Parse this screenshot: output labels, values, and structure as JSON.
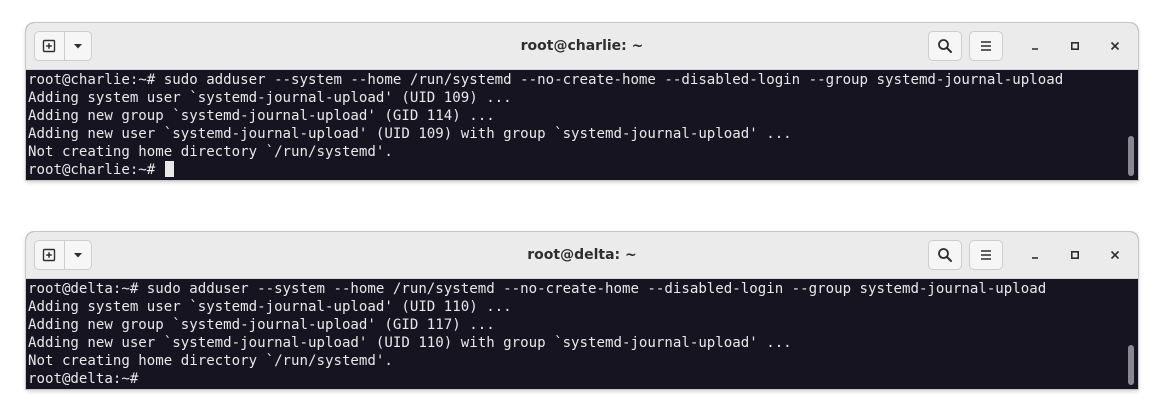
{
  "windows": [
    {
      "title": "root@charlie: ~",
      "lines": [
        "root@charlie:~# sudo adduser --system --home /run/systemd --no-create-home --disabled-login --group systemd-journal-upload",
        "Adding system user `systemd-journal-upload' (UID 109) ...",
        "Adding new group `systemd-journal-upload' (GID 114) ...",
        "Adding new user `systemd-journal-upload' (UID 109) with group `systemd-journal-upload' ...",
        "Not creating home directory `/run/systemd'.",
        "root@charlie:~# "
      ],
      "cursor_visible": true
    },
    {
      "title": "root@delta: ~",
      "lines": [
        "root@delta:~# sudo adduser --system --home /run/systemd --no-create-home --disabled-login --group systemd-journal-upload",
        "Adding system user `systemd-journal-upload' (UID 110) ...",
        "Adding new group `systemd-journal-upload' (GID 117) ...",
        "Adding new user `systemd-journal-upload' (UID 110) with group `systemd-journal-upload' ...",
        "Not creating home directory `/run/systemd'.",
        "root@delta:~# "
      ],
      "cursor_visible": false
    }
  ],
  "icons": {
    "new_tab": "new-tab-icon",
    "dropdown": "chevron-down-icon",
    "search": "search-icon",
    "menu": "hamburger-menu-icon",
    "minimize": "minimize-icon",
    "maximize": "maximize-icon",
    "close": "close-icon"
  },
  "colors": {
    "terminal_bg": "#171421",
    "terminal_fg": "#e8e8e8",
    "headerbar_bg": "#ebebeb"
  }
}
